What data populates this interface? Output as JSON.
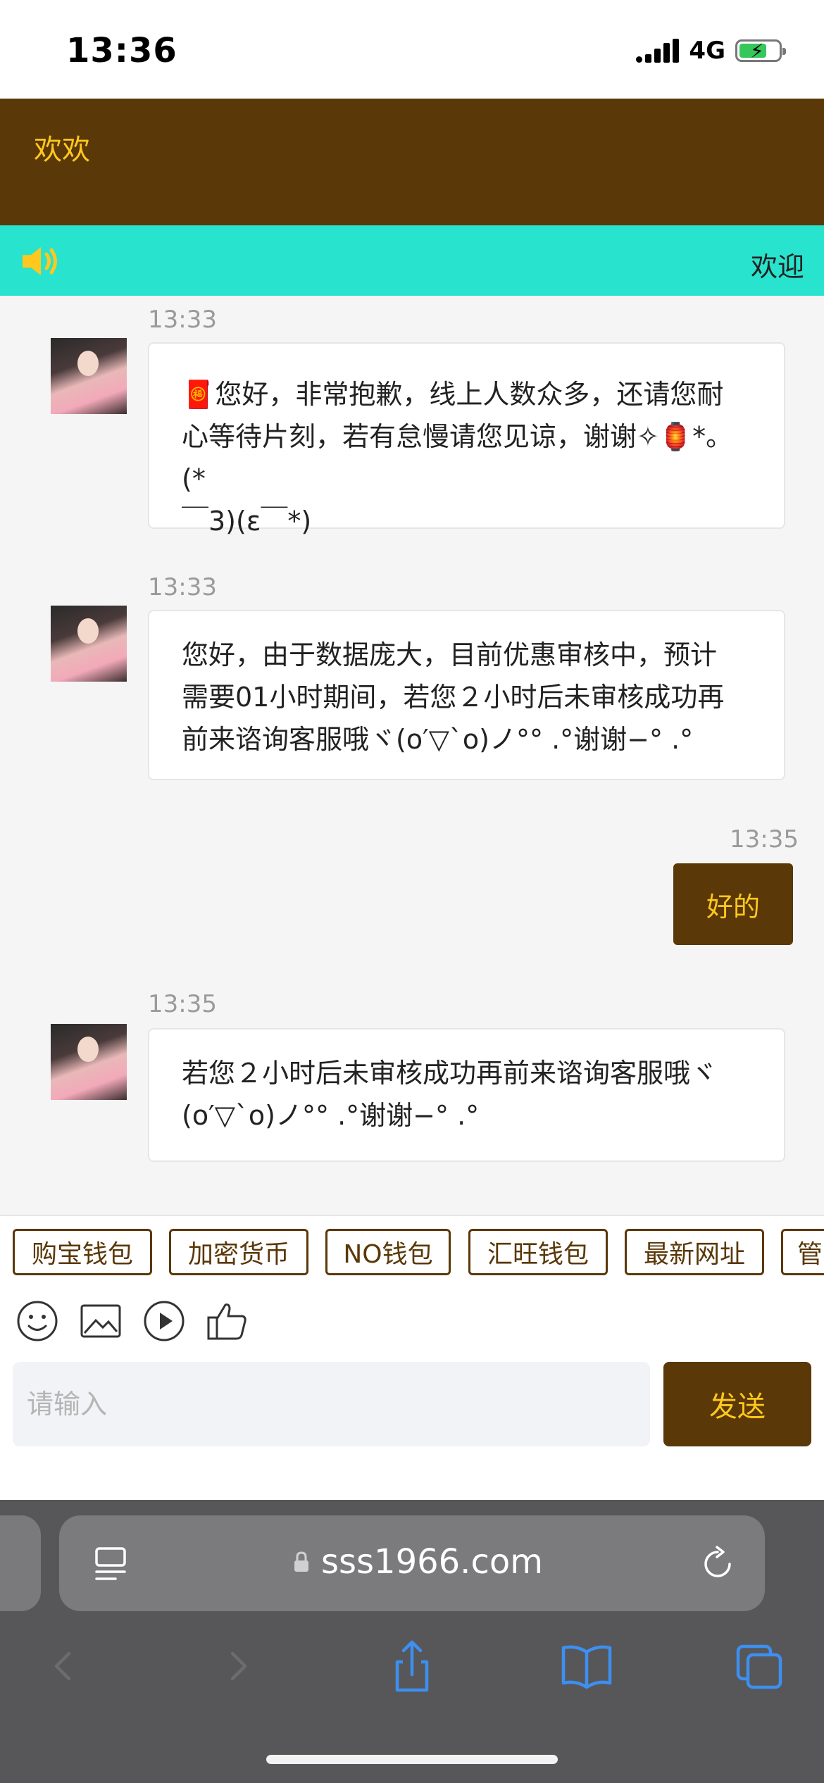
{
  "status_bar": {
    "time": "13:36",
    "network": "4G"
  },
  "header": {
    "title": "欢欢"
  },
  "notice": {
    "text": "欢迎"
  },
  "messages": [
    {
      "time": "13:33",
      "from": "agent",
      "lines": [
        "🧧您好，非常抱歉，线上人数众多，还请您耐",
        "心等待片刻，若有怠慢请您见谅，谢谢✧🏮*。(*",
        "￣3)(ε￣*)"
      ]
    },
    {
      "time": "13:33",
      "from": "agent",
      "lines": [
        "您好，由于数据庞大，目前优惠审核中，预计",
        "需要01小时期间，若您２小时后未审核成功再",
        "前来谘询客服哦ヾ(o′▽`o)ノ°° .°谢谢−° .°"
      ]
    },
    {
      "time": "13:35",
      "from": "self",
      "text": "好的"
    },
    {
      "time": "13:35",
      "from": "agent",
      "lines": [
        "若您２小时后未审核成功再前来谘询客服哦ヾ",
        "(o′▽`o)ノ°° .°谢谢−° .°"
      ]
    }
  ],
  "quick_replies": [
    "购宝钱包",
    "加密货币",
    "NO钱包",
    "汇旺钱包",
    "最新网址",
    "管"
  ],
  "toolbar": {
    "icons": [
      "emoji-icon",
      "image-icon",
      "video-icon",
      "thumbs-up-icon"
    ]
  },
  "input": {
    "placeholder": "请输入",
    "value": "",
    "send_label": "发送"
  },
  "browser": {
    "url": "sss1966.com"
  },
  "colors": {
    "brand_brown": "#5a3808",
    "brand_gold": "#ffc81e",
    "notice_teal": "#28e3cd",
    "safari_gray": "#575759"
  }
}
